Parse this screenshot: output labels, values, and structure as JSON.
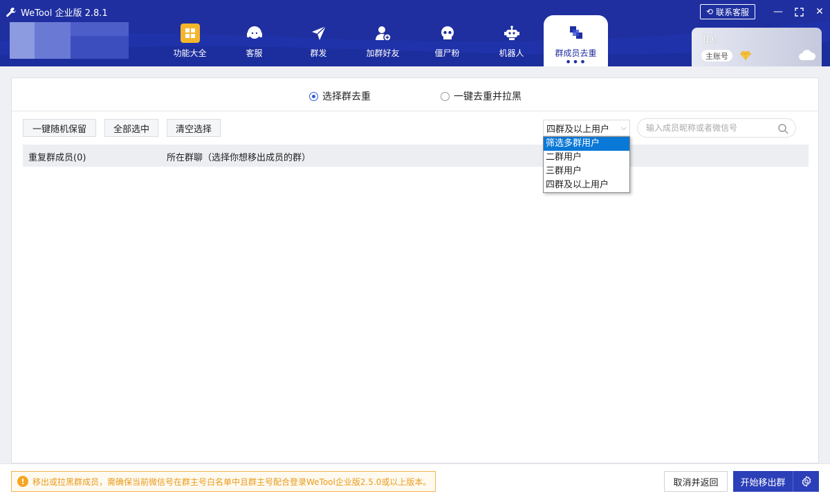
{
  "app": {
    "title": "WeTool 企业版 2.8.1"
  },
  "topbar": {
    "contact_label": "联系客服"
  },
  "nav": [
    {
      "label": "功能大全",
      "icon": "grid-icon"
    },
    {
      "label": "客服",
      "icon": "headset-icon"
    },
    {
      "label": "群发",
      "icon": "paper-plane-icon"
    },
    {
      "label": "加群好友",
      "icon": "add-user-icon"
    },
    {
      "label": "僵尸粉",
      "icon": "skull-icon"
    },
    {
      "label": "机器人",
      "icon": "robot-icon"
    },
    {
      "label": "群成员去重",
      "icon": "dedupe-icon",
      "active": true
    }
  ],
  "account": {
    "id_label": "ID:",
    "badge": "主账号"
  },
  "mode": {
    "option1": "选择群去重",
    "option2": "一键去重并拉黑",
    "selected": "选择群去重"
  },
  "toolbar": {
    "random_keep": "一键随机保留",
    "select_all": "全部选中",
    "clear_selection": "清空选择"
  },
  "filter": {
    "current": "四群及以上用户",
    "options": [
      "筛选多群用户",
      "二群用户",
      "三群用户",
      "四群及以上用户"
    ],
    "highlighted": "筛选多群用户"
  },
  "search": {
    "placeholder": "输入成员昵称或者微信号"
  },
  "table": {
    "col1": "重复群成员(0)",
    "col2": "所在群聊（选择你想移出成员的群）"
  },
  "footer": {
    "notice": "移出或拉黑群成员，需确保当前微信号在群主号白名单中且群主号配合登录WeTool企业版2.5.0或以上版本。",
    "cancel": "取消并返回",
    "start": "开始移出群"
  },
  "colors": {
    "header": "#1f2fa0",
    "accent": "#2b3fb8",
    "warning": "#f5a623"
  }
}
